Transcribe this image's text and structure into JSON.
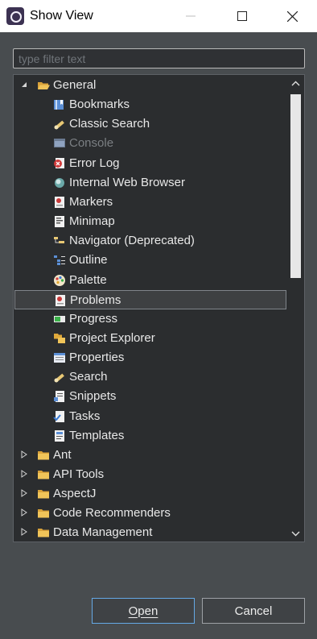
{
  "window": {
    "title": "Show View",
    "icon": "eclipse-app-icon",
    "controls": [
      "minimize",
      "maximize",
      "close"
    ]
  },
  "filter": {
    "placeholder": "type filter text",
    "value": ""
  },
  "tree": {
    "rows": [
      {
        "label": "General",
        "icon": "folder-open-icon",
        "expanded": true,
        "level": 0
      },
      {
        "label": "Bookmarks",
        "icon": "bookmarks-icon",
        "level": 1
      },
      {
        "label": "Classic Search",
        "icon": "classic-search-icon",
        "level": 1
      },
      {
        "label": "Console",
        "icon": "console-icon",
        "level": 1,
        "disabled": true
      },
      {
        "label": "Error Log",
        "icon": "error-log-icon",
        "level": 1
      },
      {
        "label": "Internal Web Browser",
        "icon": "web-browser-icon",
        "level": 1
      },
      {
        "label": "Markers",
        "icon": "markers-icon",
        "level": 1
      },
      {
        "label": "Minimap",
        "icon": "minimap-icon",
        "level": 1
      },
      {
        "label": "Navigator (Deprecated)",
        "icon": "navigator-icon",
        "level": 1
      },
      {
        "label": "Outline",
        "icon": "outline-icon",
        "level": 1
      },
      {
        "label": "Palette",
        "icon": "palette-icon",
        "level": 1
      },
      {
        "label": "Problems",
        "icon": "problems-icon",
        "level": 1,
        "selected": true
      },
      {
        "label": "Progress",
        "icon": "progress-icon",
        "level": 1
      },
      {
        "label": "Project Explorer",
        "icon": "project-explorer-icon",
        "level": 1
      },
      {
        "label": "Properties",
        "icon": "properties-icon",
        "level": 1
      },
      {
        "label": "Search",
        "icon": "search-icon",
        "level": 1
      },
      {
        "label": "Snippets",
        "icon": "snippets-icon",
        "level": 1
      },
      {
        "label": "Tasks",
        "icon": "tasks-icon",
        "level": 1
      },
      {
        "label": "Templates",
        "icon": "templates-icon",
        "level": 1
      },
      {
        "label": "Ant",
        "icon": "folder-icon",
        "expanded": false,
        "level": 0
      },
      {
        "label": "API Tools",
        "icon": "folder-icon",
        "expanded": false,
        "level": 0
      },
      {
        "label": "AspectJ",
        "icon": "folder-icon",
        "expanded": false,
        "level": 0
      },
      {
        "label": "Code Recommenders",
        "icon": "folder-icon",
        "expanded": false,
        "level": 0
      },
      {
        "label": "Data Management",
        "icon": "folder-icon",
        "expanded": false,
        "level": 0
      }
    ]
  },
  "buttons": {
    "open": "Open",
    "cancel": "Cancel"
  },
  "colors": {
    "background": "#484c4f",
    "tree_background": "#2b2d2f",
    "selection": "#3e4042",
    "focus_border": "#65a9e6",
    "folder": "#e8b64a"
  }
}
